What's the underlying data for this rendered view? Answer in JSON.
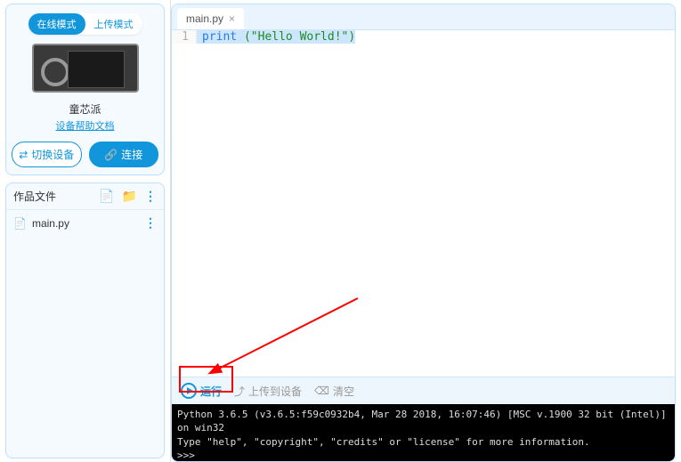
{
  "mode": {
    "online": "在线模式",
    "upload": "上传模式"
  },
  "device": {
    "name": "童芯派",
    "help_link": "设备帮助文档"
  },
  "buttons": {
    "switch": "切换设备",
    "connect": "连接"
  },
  "files": {
    "title": "作品文件",
    "items": [
      {
        "name": "main.py"
      }
    ]
  },
  "tabs": [
    {
      "label": "main.py"
    }
  ],
  "editor": {
    "line1_num": "1",
    "line1_print": "print",
    "line1_rest": " (\"Hello World!\")"
  },
  "actions": {
    "run": "运行",
    "upload": "上传到设备",
    "clear": "清空"
  },
  "terminal": {
    "l1": "Python 3.6.5 (v3.6.5:f59c0932b4, Mar 28 2018, 16:07:46) [MSC v.1900 32 bit (Intel)] on win32",
    "l2": "Type \"help\", \"copyright\", \"credits\" or \"license\" for more information.",
    "l3": ">>>"
  },
  "icons": {
    "swap": "⇄",
    "link": "🔗",
    "file_add": "📄",
    "folder_add": "📁",
    "dots": "⋮",
    "upload_ic": "⤴",
    "clear_ic": "⌫",
    "close": "×",
    "pyfile": "📄"
  }
}
